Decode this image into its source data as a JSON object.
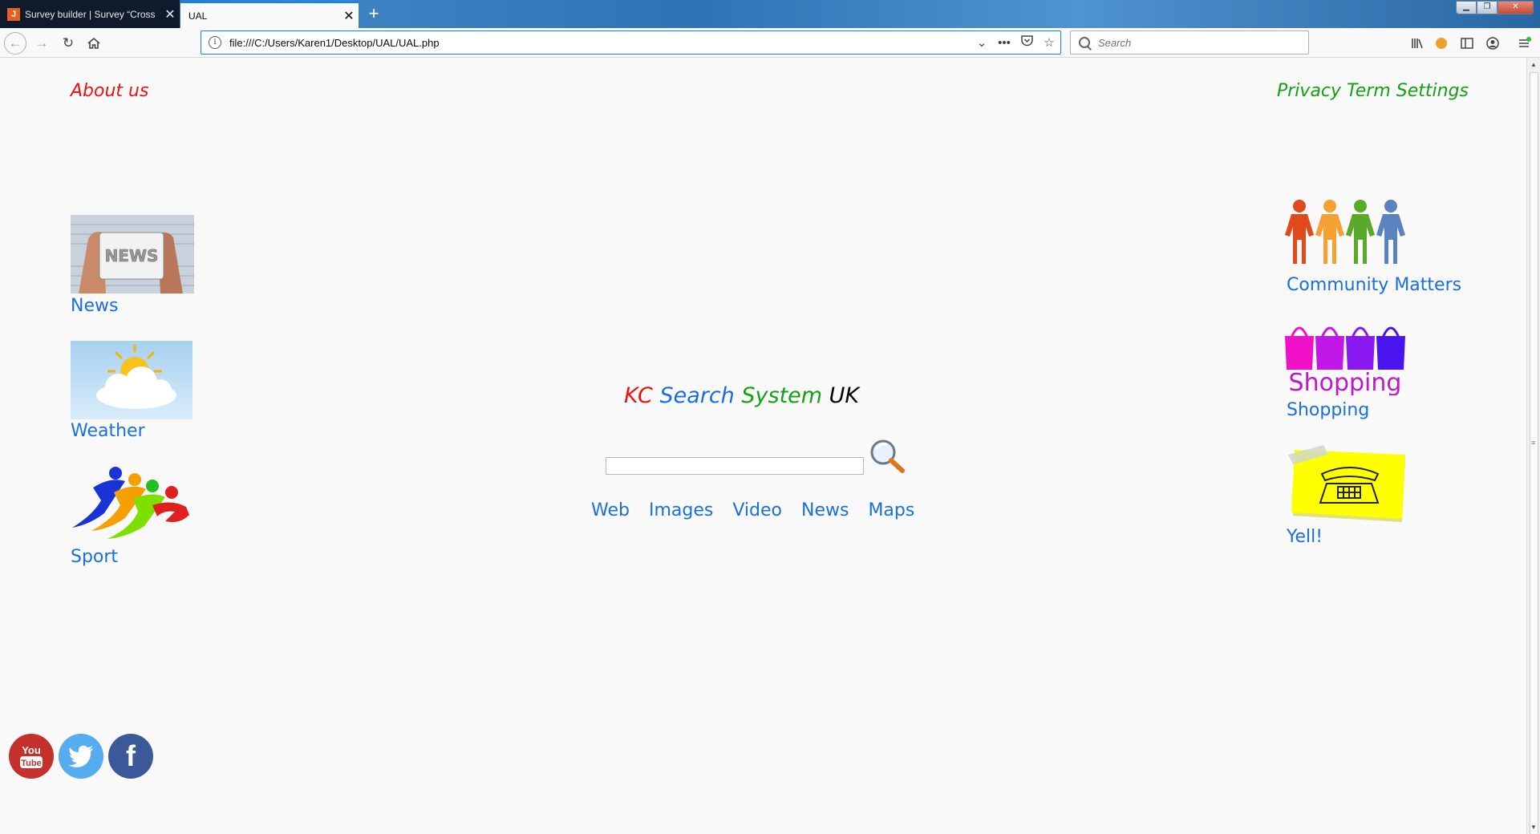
{
  "browser": {
    "tabs": [
      {
        "title": "Survey builder | Survey “Cross"
      },
      {
        "title": "UAL"
      }
    ],
    "url": "file:///C:/Users/Karen1/Desktop/UAL/UAL.php",
    "search_placeholder": "Search"
  },
  "header": {
    "about_label": "About us",
    "privacy_label": "Privacy Term Settings"
  },
  "left_nav": [
    {
      "label": "News",
      "icon": "news-icon"
    },
    {
      "label": "Weather",
      "icon": "weather-icon"
    },
    {
      "label": "Sport",
      "icon": "sport-icon"
    }
  ],
  "right_nav": [
    {
      "label": "Community Matters",
      "icon": "community-icon"
    },
    {
      "label": "Shopping",
      "icon": "shopping-bags-icon",
      "image_text": "Shopping"
    },
    {
      "label": "Yell!",
      "icon": "telephone-note-icon"
    }
  ],
  "brand": {
    "kc": "KC",
    "search": "Search",
    "system": "System",
    "uk": "UK",
    "colors": {
      "kc": "#ee1111",
      "search": "#1a6fe0",
      "system": "#15a015",
      "uk": "#000000"
    }
  },
  "search_tabs": [
    "Web",
    "Images",
    "Video",
    "News",
    "Maps"
  ],
  "social": [
    "youtube-icon",
    "twitter-icon",
    "facebook-icon"
  ],
  "social_text": {
    "youtube_top": "You",
    "youtube_bottom": "Tube",
    "facebook": "f"
  }
}
